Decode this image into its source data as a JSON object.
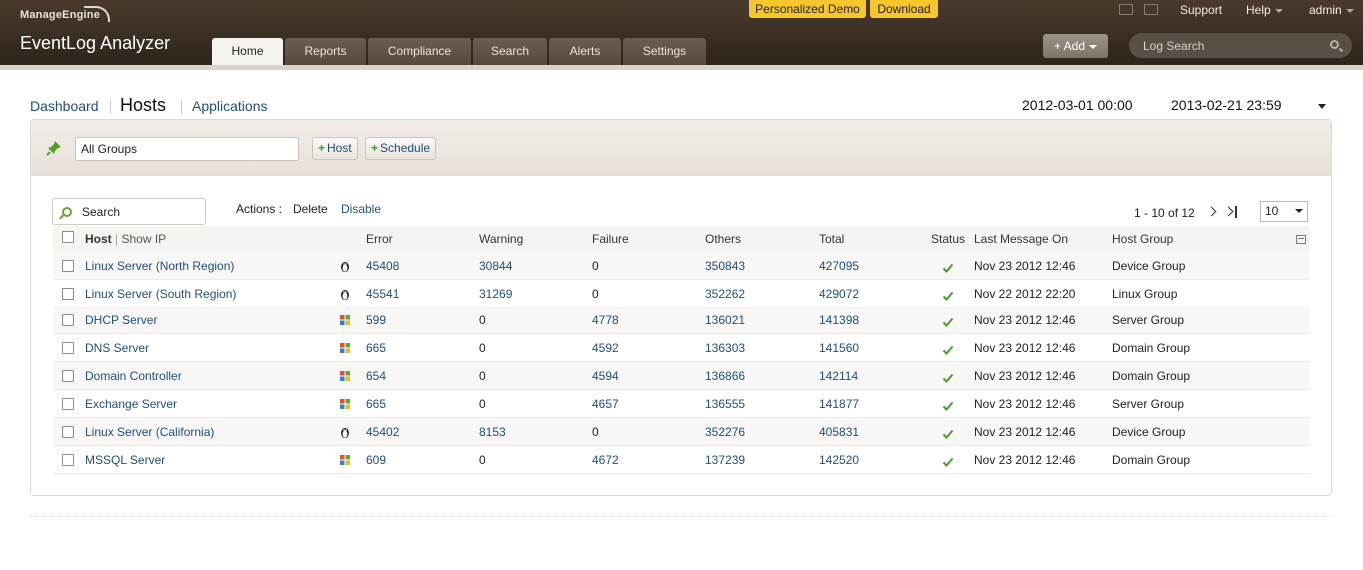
{
  "brand": {
    "vendor": "ManageEngine",
    "product": "EventLog Analyzer"
  },
  "promos": {
    "demo": "Personalized Demo",
    "download": "Download"
  },
  "tabs": [
    {
      "label": "Home"
    },
    {
      "label": "Reports"
    },
    {
      "label": "Compliance"
    },
    {
      "label": "Search"
    },
    {
      "label": "Alerts"
    },
    {
      "label": "Settings"
    }
  ],
  "toplinks": {
    "support": "Support",
    "help": "Help",
    "user": "admin"
  },
  "add_button": "+ Add",
  "log_search": {
    "placeholder": "Log Search"
  },
  "subnav": {
    "dashboard": "Dashboard",
    "hosts": "Hosts",
    "applications": "Applications"
  },
  "date_range": {
    "from": "2012-03-01 00:00",
    "to": "2013-02-21 23:59"
  },
  "toolbar": {
    "group": "All Groups",
    "host_btn": "Host",
    "schedule_btn": "Schedule"
  },
  "actions": {
    "search_placeholder": "Search",
    "label": "Actions :",
    "delete": "Delete",
    "disable": "Disable"
  },
  "pager": {
    "range": "1 - 10 of 12",
    "per_page": "10"
  },
  "columns": {
    "host": "Host",
    "show_ip": "Show IP",
    "error": "Error",
    "warning": "Warning",
    "failure": "Failure",
    "others": "Others",
    "total": "Total",
    "status": "Status",
    "last_message": "Last Message On",
    "host_group": "Host Group"
  },
  "rows": [
    {
      "host": "Linux Server (North Region)",
      "os": "linux-icon",
      "error": "45408",
      "warning": "30844",
      "failure": "0",
      "others": "350843",
      "total": "427095",
      "last": "Nov 23 2012 12:46",
      "group": "Device Group"
    },
    {
      "host": "Linux Server (South Region)",
      "os": "linux-icon",
      "error": "45541",
      "warning": "31269",
      "failure": "0",
      "others": "352262",
      "total": "429072",
      "last": "Nov 22 2012 22:20",
      "group": "Linux Group"
    },
    {
      "host": "DHCP Server",
      "os": "windows-icon",
      "error": "599",
      "warning": "0",
      "failure": "4778",
      "others": "136021",
      "total": "141398",
      "last": "Nov 23 2012 12:46",
      "group": "Server Group"
    },
    {
      "host": "DNS Server",
      "os": "windows-icon",
      "error": "665",
      "warning": "0",
      "failure": "4592",
      "others": "136303",
      "total": "141560",
      "last": "Nov 23 2012 12:46",
      "group": "Domain Group"
    },
    {
      "host": "Domain Controller",
      "os": "windows-icon",
      "error": "654",
      "warning": "0",
      "failure": "4594",
      "others": "136866",
      "total": "142114",
      "last": "Nov 23 2012 12:46",
      "group": "Domain Group"
    },
    {
      "host": "Exchange Server",
      "os": "windows-icon",
      "error": "665",
      "warning": "0",
      "failure": "4657",
      "others": "136555",
      "total": "141877",
      "last": "Nov 23 2012 12:46",
      "group": "Server Group"
    },
    {
      "host": "Linux Server (California)",
      "os": "linux-icon",
      "error": "45402",
      "warning": "8153",
      "failure": "0",
      "others": "352276",
      "total": "405831",
      "last": "Nov 23 2012 12:46",
      "group": "Device Group"
    },
    {
      "host": "MSSQL Server",
      "os": "windows-icon",
      "error": "609",
      "warning": "0",
      "failure": "4672",
      "others": "137239",
      "total": "142520",
      "last": "Nov 23 2012 12:46",
      "group": "Domain Group"
    }
  ],
  "colors": {
    "link": "#1f4f7a",
    "header_bg": "#3a2e24",
    "promo": "#f7c52c",
    "ok_status": "#4a9a2f"
  }
}
